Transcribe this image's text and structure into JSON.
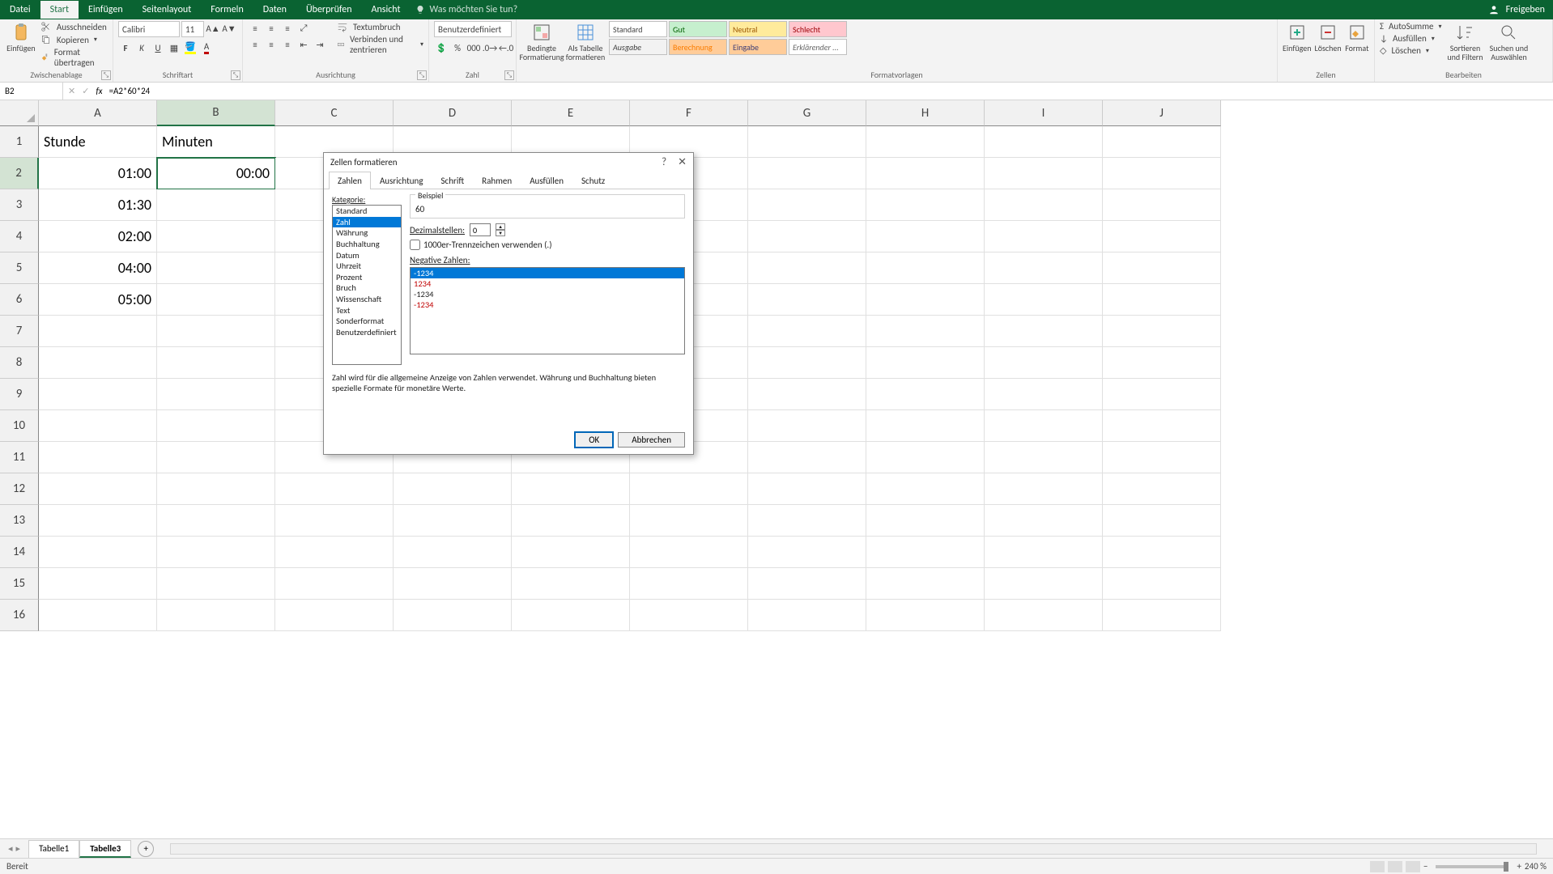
{
  "titlebar": {
    "menus": [
      "Datei",
      "Start",
      "Einfügen",
      "Seitenlayout",
      "Formeln",
      "Daten",
      "Überprüfen",
      "Ansicht"
    ],
    "active_menu_index": 1,
    "tellme_placeholder": "Was möchten Sie tun?",
    "share": "Freigeben"
  },
  "ribbon": {
    "clipboard": {
      "paste": "Einfügen",
      "cut": "Ausschneiden",
      "copy": "Kopieren",
      "format_painter": "Format übertragen",
      "label": "Zwischenablage"
    },
    "font": {
      "name": "Calibri",
      "size": "11",
      "bold": "F",
      "italic": "K",
      "underline": "U",
      "label": "Schriftart"
    },
    "align": {
      "wrap": "Textumbruch",
      "merge": "Verbinden und zentrieren",
      "label": "Ausrichtung"
    },
    "number": {
      "format_selected": "Benutzerdefiniert",
      "label": "Zahl"
    },
    "cond": {
      "cond": "Bedingte Formatierung",
      "table": "Als Tabelle formatieren"
    },
    "styles": {
      "standard": "Standard",
      "gut": "Gut",
      "neutral": "Neutral",
      "schlecht": "Schlecht",
      "ausgabe": "Ausgabe",
      "berechnung": "Berechnung",
      "eingabe": "Eingabe",
      "erklar": "Erklärender ...",
      "label": "Formatvorlagen"
    },
    "cells": {
      "insert": "Einfügen",
      "delete": "Löschen",
      "format": "Format",
      "label": "Zellen"
    },
    "editing": {
      "autosum": "AutoSumme",
      "fill": "Ausfüllen",
      "clear": "Löschen",
      "sort": "Sortieren und Filtern",
      "find": "Suchen und Auswählen",
      "label": "Bearbeiten"
    }
  },
  "namebox": "B2",
  "formula": "=A2*60*24",
  "columns": [
    "A",
    "B",
    "C",
    "D",
    "E",
    "F",
    "G",
    "H",
    "I",
    "J"
  ],
  "sel_col_index": 1,
  "headers": {
    "A": "Stunde",
    "B": "Minuten"
  },
  "data_rows": [
    {
      "r": 1,
      "A": "Stunde",
      "B": "Minuten"
    },
    {
      "r": 2,
      "A": "01:00",
      "B": "00:00",
      "selB": true
    },
    {
      "r": 3,
      "A": "01:30",
      "B": ""
    },
    {
      "r": 4,
      "A": "02:00",
      "B": ""
    },
    {
      "r": 5,
      "A": "04:00",
      "B": ""
    },
    {
      "r": 6,
      "A": "05:00",
      "B": ""
    }
  ],
  "extra_rows": [
    7,
    8,
    9,
    10,
    11,
    12,
    13,
    14,
    15,
    16
  ],
  "sheets": [
    "Tabelle1",
    "Tabelle3"
  ],
  "active_sheet_index": 1,
  "status": {
    "ready": "Bereit",
    "zoom": "240 %"
  },
  "dialog": {
    "title": "Zellen formatieren",
    "tabs": [
      "Zahlen",
      "Ausrichtung",
      "Schrift",
      "Rahmen",
      "Ausfüllen",
      "Schutz"
    ],
    "active_tab_index": 0,
    "category_label": "Kategorie:",
    "categories": [
      "Standard",
      "Zahl",
      "Währung",
      "Buchhaltung",
      "Datum",
      "Uhrzeit",
      "Prozent",
      "Bruch",
      "Wissenschaft",
      "Text",
      "Sonderformat",
      "Benutzerdefiniert"
    ],
    "selected_category_index": 1,
    "sample_label": "Beispiel",
    "sample_value": "60",
    "decimals_label": "Dezimalstellen:",
    "decimals_value": "0",
    "thousands_label": "1000er-Trennzeichen verwenden (.)",
    "negative_label": "Negative Zahlen:",
    "negative_options": [
      {
        "text": "-1234",
        "red": true,
        "sel": true
      },
      {
        "text": "1234",
        "red": true
      },
      {
        "text": "-1234",
        "red": false
      },
      {
        "text": "-1234",
        "red": true
      }
    ],
    "description": "Zahl wird für die allgemeine Anzeige von Zahlen verwendet. Währung und Buchhaltung bieten spezielle Formate für monetäre Werte.",
    "ok": "OK",
    "cancel": "Abbrechen"
  }
}
